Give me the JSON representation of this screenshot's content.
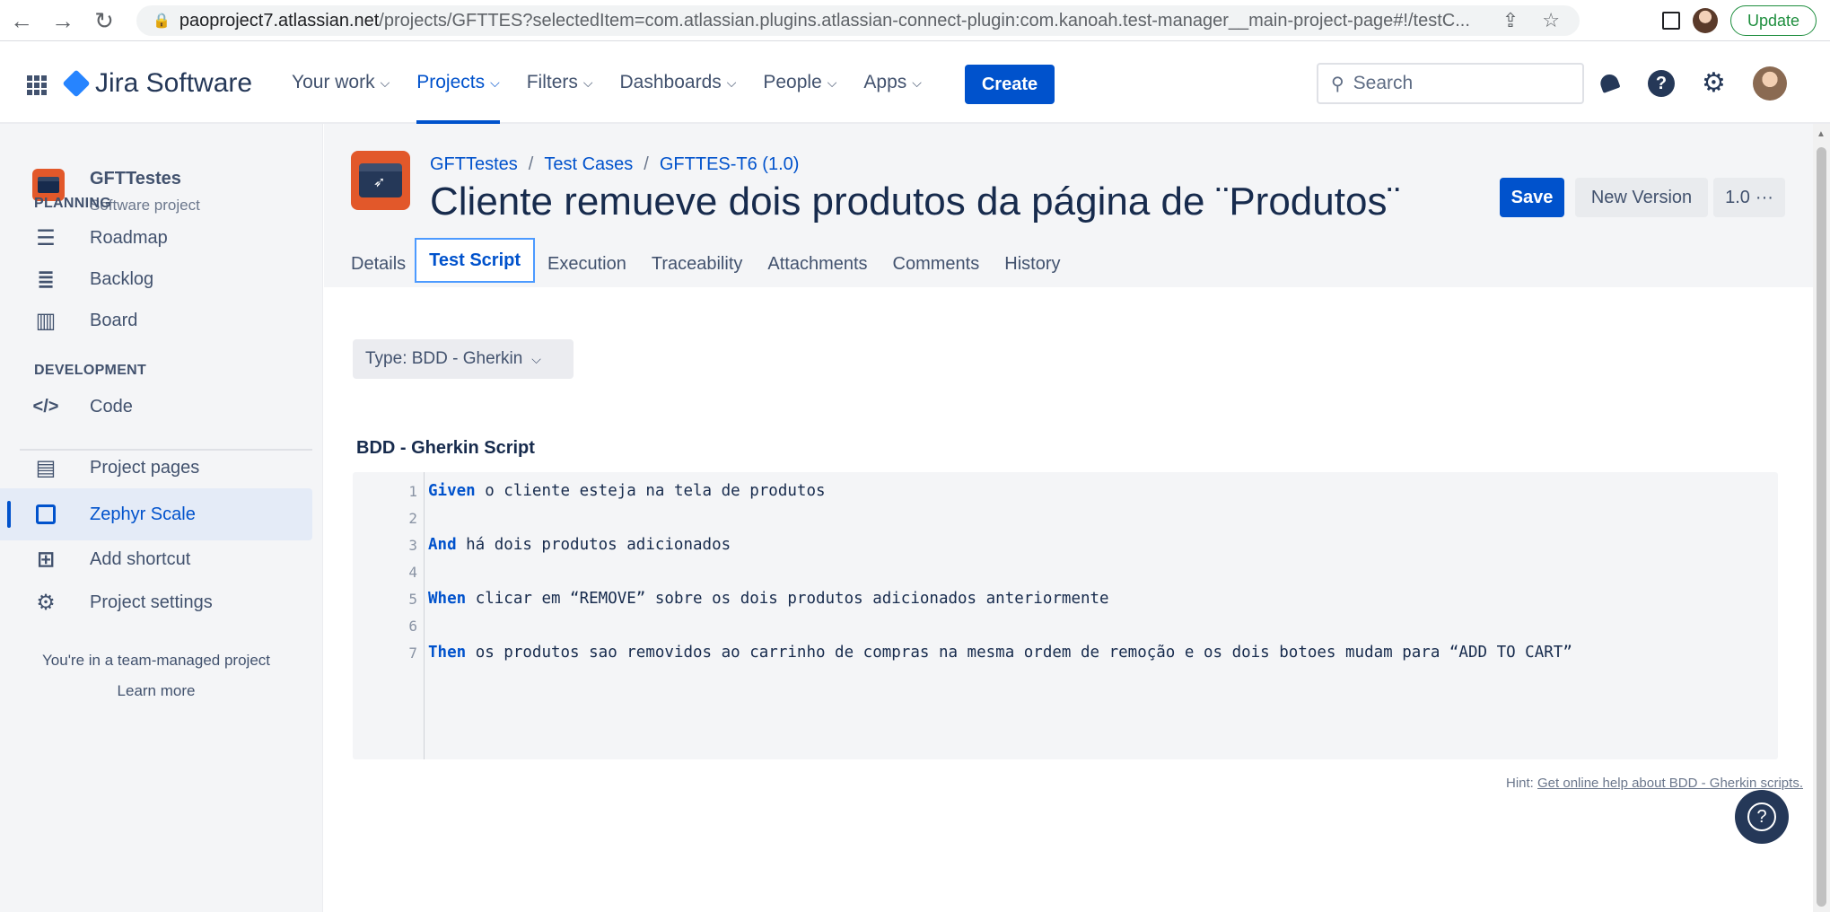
{
  "browser": {
    "url_host": "paoproject7.atlassian.net",
    "url_path": "/projects/GFTTES?selectedItem=com.atlassian.plugins.atlassian-connect-plugin:com.kanoah.test-manager__main-project-page#!/testC...",
    "update_label": "Update"
  },
  "topnav": {
    "logo_text": "Jira Software",
    "items": [
      {
        "label": "Your work"
      },
      {
        "label": "Projects"
      },
      {
        "label": "Filters"
      },
      {
        "label": "Dashboards"
      },
      {
        "label": "People"
      },
      {
        "label": "Apps"
      }
    ],
    "create_label": "Create",
    "search_placeholder": "Search"
  },
  "sidebar": {
    "project_name": "GFTTestes",
    "project_type": "Software project",
    "planning_title": "PLANNING",
    "development_title": "DEVELOPMENT",
    "items": {
      "roadmap": "Roadmap",
      "backlog": "Backlog",
      "board": "Board",
      "code": "Code",
      "project_pages": "Project pages",
      "zephyr_scale": "Zephyr Scale",
      "add_shortcut": "Add shortcut",
      "project_settings": "Project settings"
    },
    "footer_text": "You're in a team-managed project",
    "learn_more": "Learn more"
  },
  "header": {
    "breadcrumb": [
      "GFTTestes",
      "Test Cases",
      "GFTTES-T6 (1.0)"
    ],
    "title": "Cliente remueve dois produtos da página de ¨Produtos¨",
    "save_label": "Save",
    "new_version_label": "New Version",
    "version_label": "1.0",
    "tabs": [
      "Details",
      "Test Script",
      "Execution",
      "Traceability",
      "Attachments",
      "Comments",
      "History"
    ]
  },
  "script": {
    "type_label": "Type: BDD - Gherkin",
    "section_title": "BDD - Gherkin Script",
    "lines": [
      {
        "num": "1",
        "keyword": "Given",
        "text": " o cliente esteja na tela de produtos"
      },
      {
        "num": "2",
        "keyword": "",
        "text": ""
      },
      {
        "num": "3",
        "keyword": "And",
        "text": " há dois produtos adicionados"
      },
      {
        "num": "4",
        "keyword": "",
        "text": ""
      },
      {
        "num": "5",
        "keyword": "When",
        "text": " clicar em “REMOVE” sobre os dois produtos adicionados anteriormente"
      },
      {
        "num": "6",
        "keyword": "",
        "text": ""
      },
      {
        "num": "7",
        "keyword": "Then",
        "text": " os produtos sao removidos ao carrinho de compras na mesma ordem de remoção e os dois botoes mudam para “ADD TO CART”"
      }
    ],
    "hint_prefix": "Hint: ",
    "hint_link": "Get online help about BDD - Gherkin scripts."
  },
  "colors": {
    "accent": "#0052cc",
    "project_icon": "#e2582a"
  }
}
